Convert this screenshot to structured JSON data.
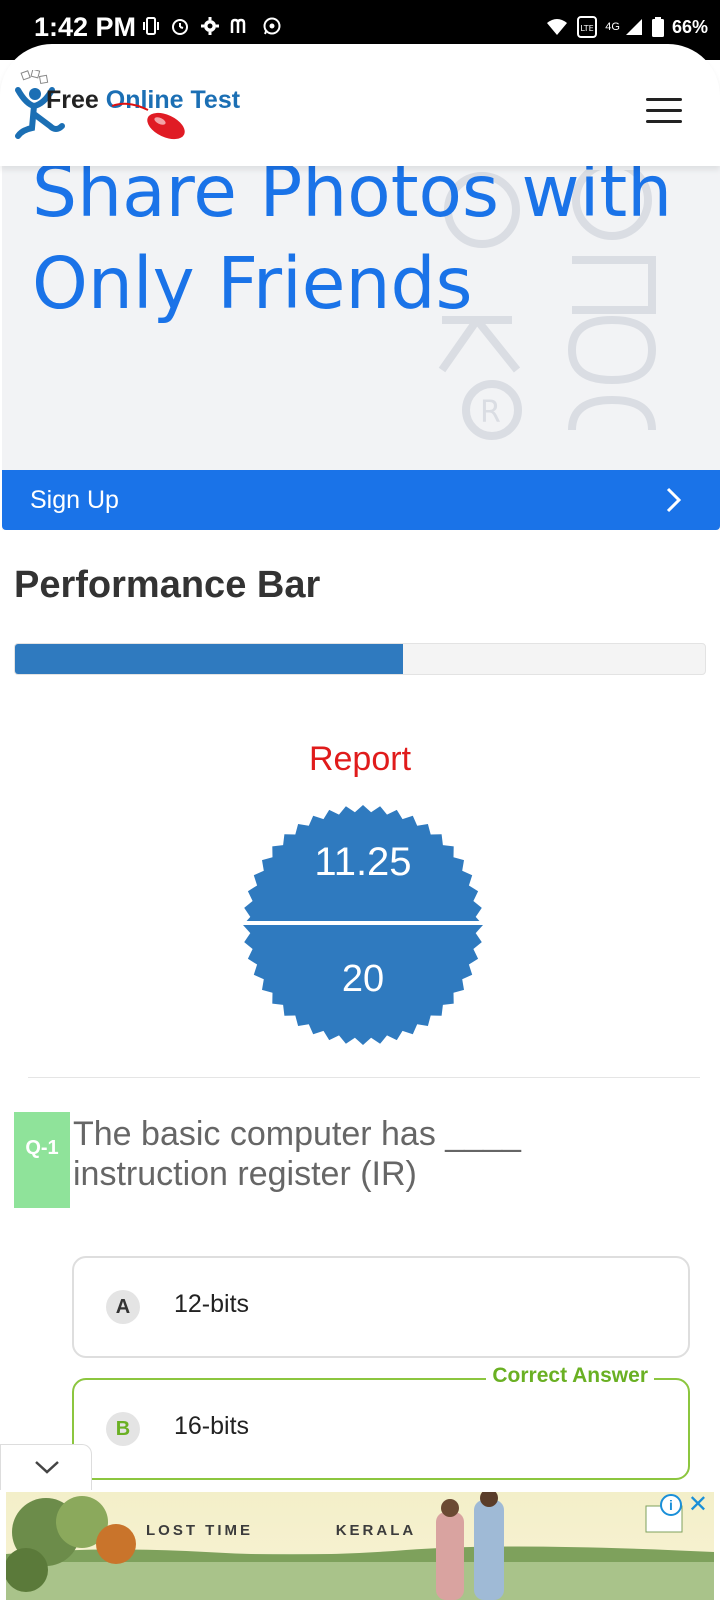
{
  "status_bar": {
    "time": "1:42 PM",
    "left_icons": [
      "vibrate-icon",
      "alarm-icon",
      "settings-icon",
      "mail-icon",
      "whatsapp-icon"
    ],
    "right_icons": [
      "wifi-icon",
      "volte-icon",
      "signal-icon",
      "battery-icon"
    ],
    "network": "4G",
    "battery": "66%"
  },
  "header": {
    "logo_free": "Free",
    "logo_online": "Online Test",
    "menu_icon": "hamburger-menu-icon"
  },
  "ad_top": {
    "headline": "Share Photos with Only Friends",
    "signup_label": "Sign Up",
    "accent_color": "#1a73e8"
  },
  "performance": {
    "title": "Performance Bar",
    "progress_fraction": 0.5625,
    "bar_color": "#2f7abf"
  },
  "report": {
    "label": "Report",
    "score": "11.25",
    "total": "20"
  },
  "question": {
    "badge": "Q-1",
    "text": "The basic computer has ____ instruction register (IR)",
    "options": [
      {
        "letter": "A",
        "text": "12-bits"
      },
      {
        "letter": "B",
        "text": "16-bits"
      }
    ],
    "correct_label": "Correct Answer"
  },
  "ad_bottom": {
    "text_left": "LOST TIME",
    "text_right": "KERALA",
    "info_label": "i",
    "close_label": "✕"
  }
}
